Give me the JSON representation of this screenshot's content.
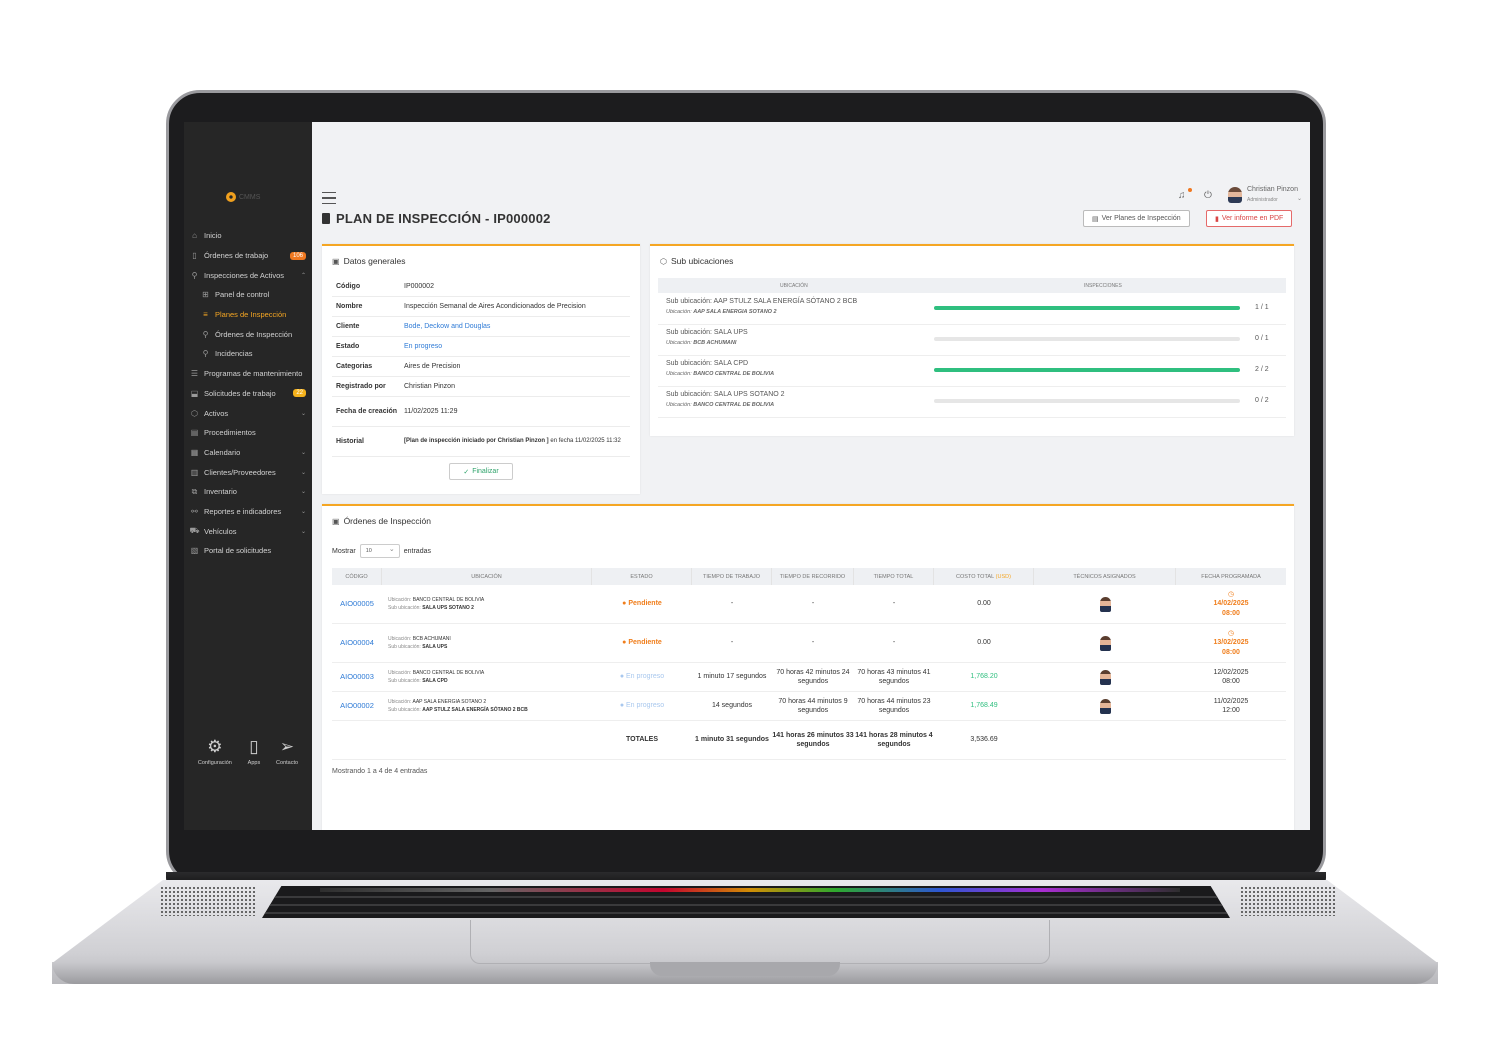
{
  "app": {
    "logo_text": "CMMS"
  },
  "sidebar": {
    "items": [
      {
        "label": "Inicio",
        "icon": "home-icon"
      },
      {
        "label": "Órdenes de trabajo",
        "icon": "clipboard-icon",
        "badge": "106"
      },
      {
        "label": "Inspecciones de Activos",
        "icon": "inspect-icon"
      },
      {
        "label": "Panel de control",
        "icon": "grid-icon"
      },
      {
        "label": "Planes de Inspección",
        "icon": "list-icon"
      },
      {
        "label": "Órdenes de Inspección",
        "icon": "search-doc-icon"
      },
      {
        "label": "Incidencias",
        "icon": "alert-icon"
      },
      {
        "label": "Programas de mantenimiento",
        "icon": "program-icon"
      },
      {
        "label": "Solicitudes de trabajo",
        "icon": "inbox-icon",
        "badge": "22"
      },
      {
        "label": "Activos",
        "icon": "cube-icon"
      },
      {
        "label": "Procedimientos",
        "icon": "doc-icon"
      },
      {
        "label": "Calendario",
        "icon": "calendar-icon"
      },
      {
        "label": "Clientes/Proveedores",
        "icon": "building-icon"
      },
      {
        "label": "Inventario",
        "icon": "inventory-icon"
      },
      {
        "label": "Reportes e indicadores",
        "icon": "chart-icon"
      },
      {
        "label": "Vehículos",
        "icon": "car-icon"
      },
      {
        "label": "Portal de solicitudes",
        "icon": "portal-icon"
      }
    ],
    "bottom": [
      {
        "label": "Configuración",
        "icon": "gear-icon"
      },
      {
        "label": "Apps",
        "icon": "phone-icon"
      },
      {
        "label": "Contacto",
        "icon": "send-icon"
      }
    ]
  },
  "header": {
    "user_name": "Christian Pinzon",
    "user_role": "Administrador"
  },
  "page": {
    "title": "PLAN DE INSPECCIÓN - IP000002",
    "btn_plans": "Ver Planes de Inspección",
    "btn_pdf": "Ver informe en PDF"
  },
  "datos": {
    "title": "Datos generales",
    "rows": [
      {
        "k": "Código",
        "v": "IP000002"
      },
      {
        "k": "Nombre",
        "v": "Inspección Semanal de Aires Acondicionados de Precision"
      },
      {
        "k": "Cliente",
        "v": "Bode, Deckow and Douglas"
      },
      {
        "k": "Estado",
        "v": "En progreso"
      },
      {
        "k": "Categorias",
        "v": "Aires de Precision"
      },
      {
        "k": "Registrado por",
        "v": "Christian Pinzon"
      },
      {
        "k": "Fecha de creación",
        "v": "11/02/2025 11:29"
      },
      {
        "k": "Historial",
        "v_bold": "[Plan de inspección iniciado por Christian Pinzon ]",
        "v": " en fecha 11/02/2025 11:32"
      }
    ],
    "btn_finalizar": "Finalizar"
  },
  "sub": {
    "title": "Sub ubicaciones",
    "col_ubicacion": "UBICACIÓN",
    "col_inspecciones": "INSPECCIONES",
    "sub_prefix": "Sub ubicación:",
    "ubi_prefix": "Ubicación:",
    "rows": [
      {
        "name": "AAP STULZ SALA ENERGÍA SÓTANO 2 BCB",
        "ubicacion": "AAP SALA ENERGIA SOTANO 2",
        "done": 1,
        "total": 1,
        "count": "1 / 1"
      },
      {
        "name": "SALA UPS",
        "ubicacion": "BCB ACHUMANI",
        "done": 0,
        "total": 1,
        "count": "0 / 1"
      },
      {
        "name": "SALA CPD",
        "ubicacion": "BANCO CENTRAL DE BOLIVIA",
        "done": 2,
        "total": 2,
        "count": "2 / 2"
      },
      {
        "name": "SALA UPS SOTANO 2",
        "ubicacion": "BANCO CENTRAL DE BOLIVIA",
        "done": 0,
        "total": 2,
        "count": "0 / 2"
      }
    ]
  },
  "ordenes": {
    "title": "Órdenes de Inspección",
    "mostrar": "Mostrar",
    "page_size": "10",
    "entradas": "entradas",
    "columns": [
      "CÓDIGO",
      "UBICACIÓN",
      "ESTADO",
      "TIEMPO DE TRABAJO",
      "TIEMPO DE RECORRIDO",
      "TIEMPO TOTAL",
      "COSTO TOTAL",
      "TÉCNICOS ASIGNADOS",
      "FECHA PROGRAMADA"
    ],
    "currency": "(USD)",
    "ubi_prefix": "Ubicación:",
    "sub_prefix": "Sub ubicación:",
    "rows": [
      {
        "code": "AIO00005",
        "ubicacion": "BANCO CENTRAL DE BOLIVIA",
        "sub": "SALA UPS SOTANO 2",
        "estado": "Pendiente",
        "estado_type": "pend",
        "trabajo": "-",
        "recorrido": "-",
        "total": "-",
        "costo": "0.00",
        "fecha1": "14/02/2025",
        "fecha2": "08:00",
        "overdue": true
      },
      {
        "code": "AIO00004",
        "ubicacion": "BCB ACHUMANI",
        "sub": "SALA UPS",
        "estado": "Pendiente",
        "estado_type": "pend",
        "trabajo": "-",
        "recorrido": "-",
        "total": "-",
        "costo": "0.00",
        "fecha1": "13/02/2025",
        "fecha2": "08:00",
        "overdue": true
      },
      {
        "code": "AIO00003",
        "ubicacion": "BANCO CENTRAL DE BOLIVIA",
        "sub": "SALA CPD",
        "estado": "En progreso",
        "estado_type": "prog",
        "trabajo": "1 minuto 17 segundos",
        "recorrido": "70 horas 42 minutos 24 segundos",
        "total": "70 horas 43 minutos 41 segundos",
        "costo": "1,768.20",
        "fecha1": "12/02/2025",
        "fecha2": "08:00",
        "overdue": false
      },
      {
        "code": "AIO00002",
        "ubicacion": "AAP SALA ENERGIA SOTANO 2",
        "sub": "AAP STULZ SALA ENERGÍA SÓTANO 2 BCB",
        "estado": "En progreso",
        "estado_type": "prog",
        "trabajo": "14 segundos",
        "recorrido": "70 horas 44 minutos 9 segundos",
        "total": "70 horas 44 minutos 23 segundos",
        "costo": "1,768.49",
        "fecha1": "11/02/2025",
        "fecha2": "12:00",
        "overdue": false
      }
    ],
    "totales": {
      "label": "TOTALES",
      "trabajo": "1 minuto 31 segundos",
      "recorrido": "141 horas 26 minutos 33 segundos",
      "total": "141 horas 28 minutos 4 segundos",
      "costo": "3,536.69"
    },
    "footer": "Mostrando 1 a 4 de 4 entradas"
  },
  "colors": {
    "accent": "#f5a623",
    "link": "#2f7bd6",
    "success": "#2fbf7f",
    "pending": "#f07e1c",
    "sidebar": "#262626"
  }
}
